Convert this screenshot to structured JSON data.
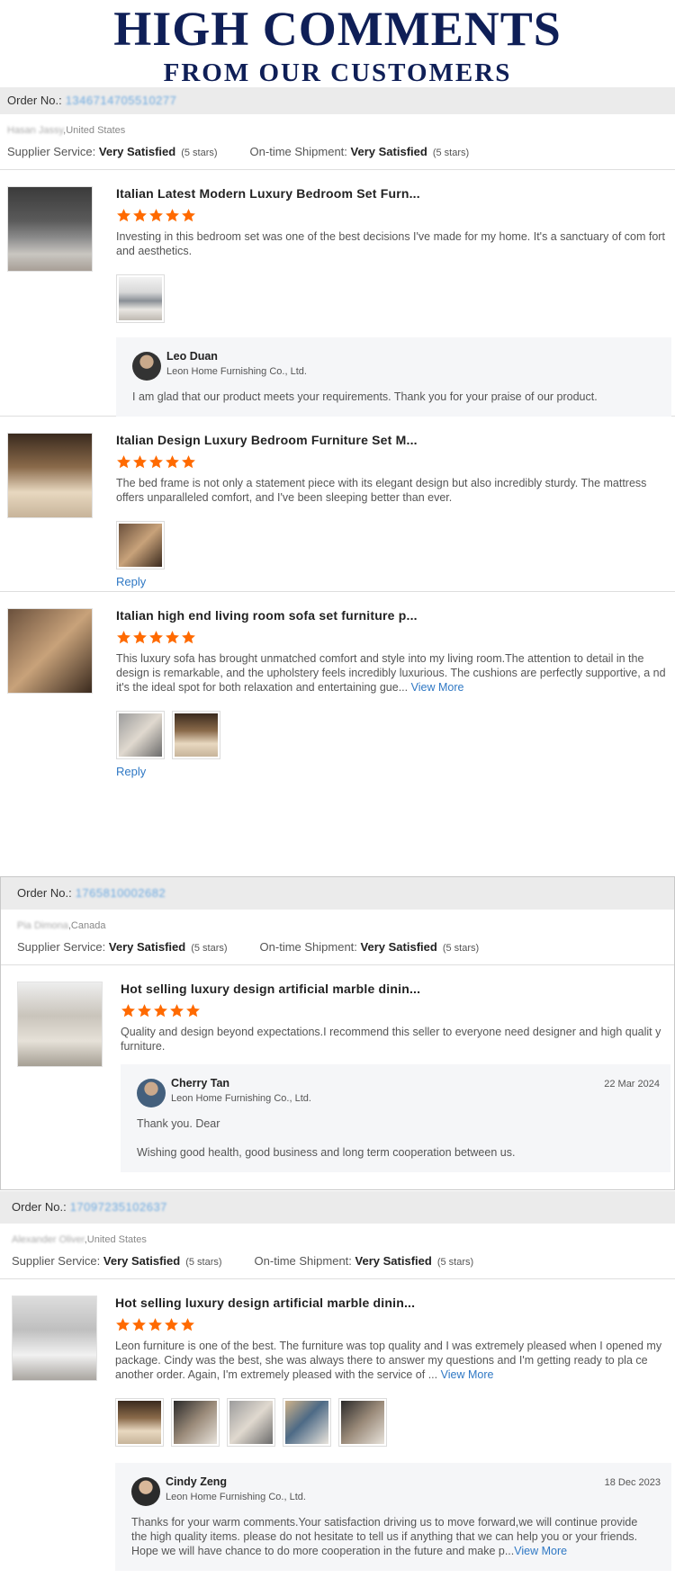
{
  "header": {
    "title": "HIGH COMMENTS",
    "subtitle": "FROM OUR CUSTOMERS"
  },
  "colors": {
    "brand_navy": "#0f1f57",
    "star_orange": "#ff6a00",
    "link_blue": "#2f78c4"
  },
  "orders": [
    {
      "order_label": "Order No.:",
      "order_no": "1346714705510277",
      "location_blur": "Hasan Jassy",
      "country": "United States",
      "supplier_label": "Supplier Service:",
      "supplier_value": "Very Satisfied",
      "supplier_stars": "(5 stars)",
      "shipment_label": "On-time Shipment:",
      "shipment_value": "Very Satisfied",
      "shipment_stars": "(5 stars)",
      "reviews": [
        {
          "title": "Italian Latest Modern Luxury Bedroom Set Furn...",
          "rating": 5,
          "text": "Investing in this bedroom set was one of the best decisions I've made for my home. It's a sanctuary of com fort and aesthetics.",
          "reply": {
            "name": "Leo Duan",
            "company": "Leon Home Furnishing Co., Ltd.",
            "messages": [
              "I am glad that our product meets your requirements. Thank you for your praise of our product."
            ]
          }
        },
        {
          "title": "Italian Design Luxury Bedroom Furniture Set M...",
          "rating": 5,
          "text": "The bed frame is not only a statement piece with its elegant design but also incredibly sturdy. The mattress offers unparalleled comfort, and I've been sleeping better than ever.",
          "reply_link": "Reply"
        },
        {
          "title": "Italian high end living room sofa set furniture p...",
          "rating": 5,
          "text": "This luxury sofa has brought unmatched comfort and style into my living room.The attention to detail in the design is remarkable, and the upholstery feels incredibly luxurious. The cushions are perfectly supportive, a nd it's the ideal spot for both relaxation and entertaining gue...",
          "view_more": "View More",
          "reply_link": "Reply"
        }
      ]
    },
    {
      "order_label": "Order No.:",
      "order_no": "1765810002682",
      "location_blur": "Pia Dimona",
      "country": "Canada",
      "supplier_label": "Supplier Service:",
      "supplier_value": "Very Satisfied",
      "supplier_stars": "(5 stars)",
      "shipment_label": "On-time Shipment:",
      "shipment_value": "Very Satisfied",
      "shipment_stars": "(5 stars)",
      "reviews": [
        {
          "title": "Hot selling luxury design artificial marble dinin...",
          "rating": 5,
          "text": "Quality and design beyond expectations.I recommend this seller to everyone need designer and high qualit y furniture.",
          "reply": {
            "name": "Cherry Tan",
            "company": "Leon Home Furnishing Co., Ltd.",
            "date": "22 Mar 2024",
            "messages": [
              "Thank you. Dear",
              "Wishing good health, good business and long term cooperation between us."
            ]
          }
        }
      ]
    },
    {
      "order_label": "Order No.:",
      "order_no": "17097235102637",
      "location_blur": "Alexander Oliver",
      "country": "United States",
      "supplier_label": "Supplier Service:",
      "supplier_value": "Very Satisfied",
      "supplier_stars": "(5 stars)",
      "shipment_label": "On-time Shipment:",
      "shipment_value": "Very Satisfied",
      "shipment_stars": "(5 stars)",
      "reviews": [
        {
          "title": "Hot selling luxury design artificial marble dinin...",
          "rating": 5,
          "text": "Leon furniture is one of the best. The furniture was top quality and I was extremely pleased when I opened my package. Cindy was the best, she was always there to answer my questions and I'm getting ready to pla ce another order. Again, I'm extremely pleased with the service of ...",
          "view_more": "View More",
          "reply": {
            "name": "Cindy Zeng",
            "company": "Leon Home Furnishing Co., Ltd.",
            "date": "18 Dec 2023",
            "messages": [
              "Thanks for your warm comments.Your satisfaction driving us to move forward,we will continue provide the high quality items. please do not hesitate to tell us if anything that we can help you or your friends. Hope we will have chance to do more cooperation in the future and make p..."
            ],
            "view_more": "View More"
          }
        }
      ]
    }
  ]
}
